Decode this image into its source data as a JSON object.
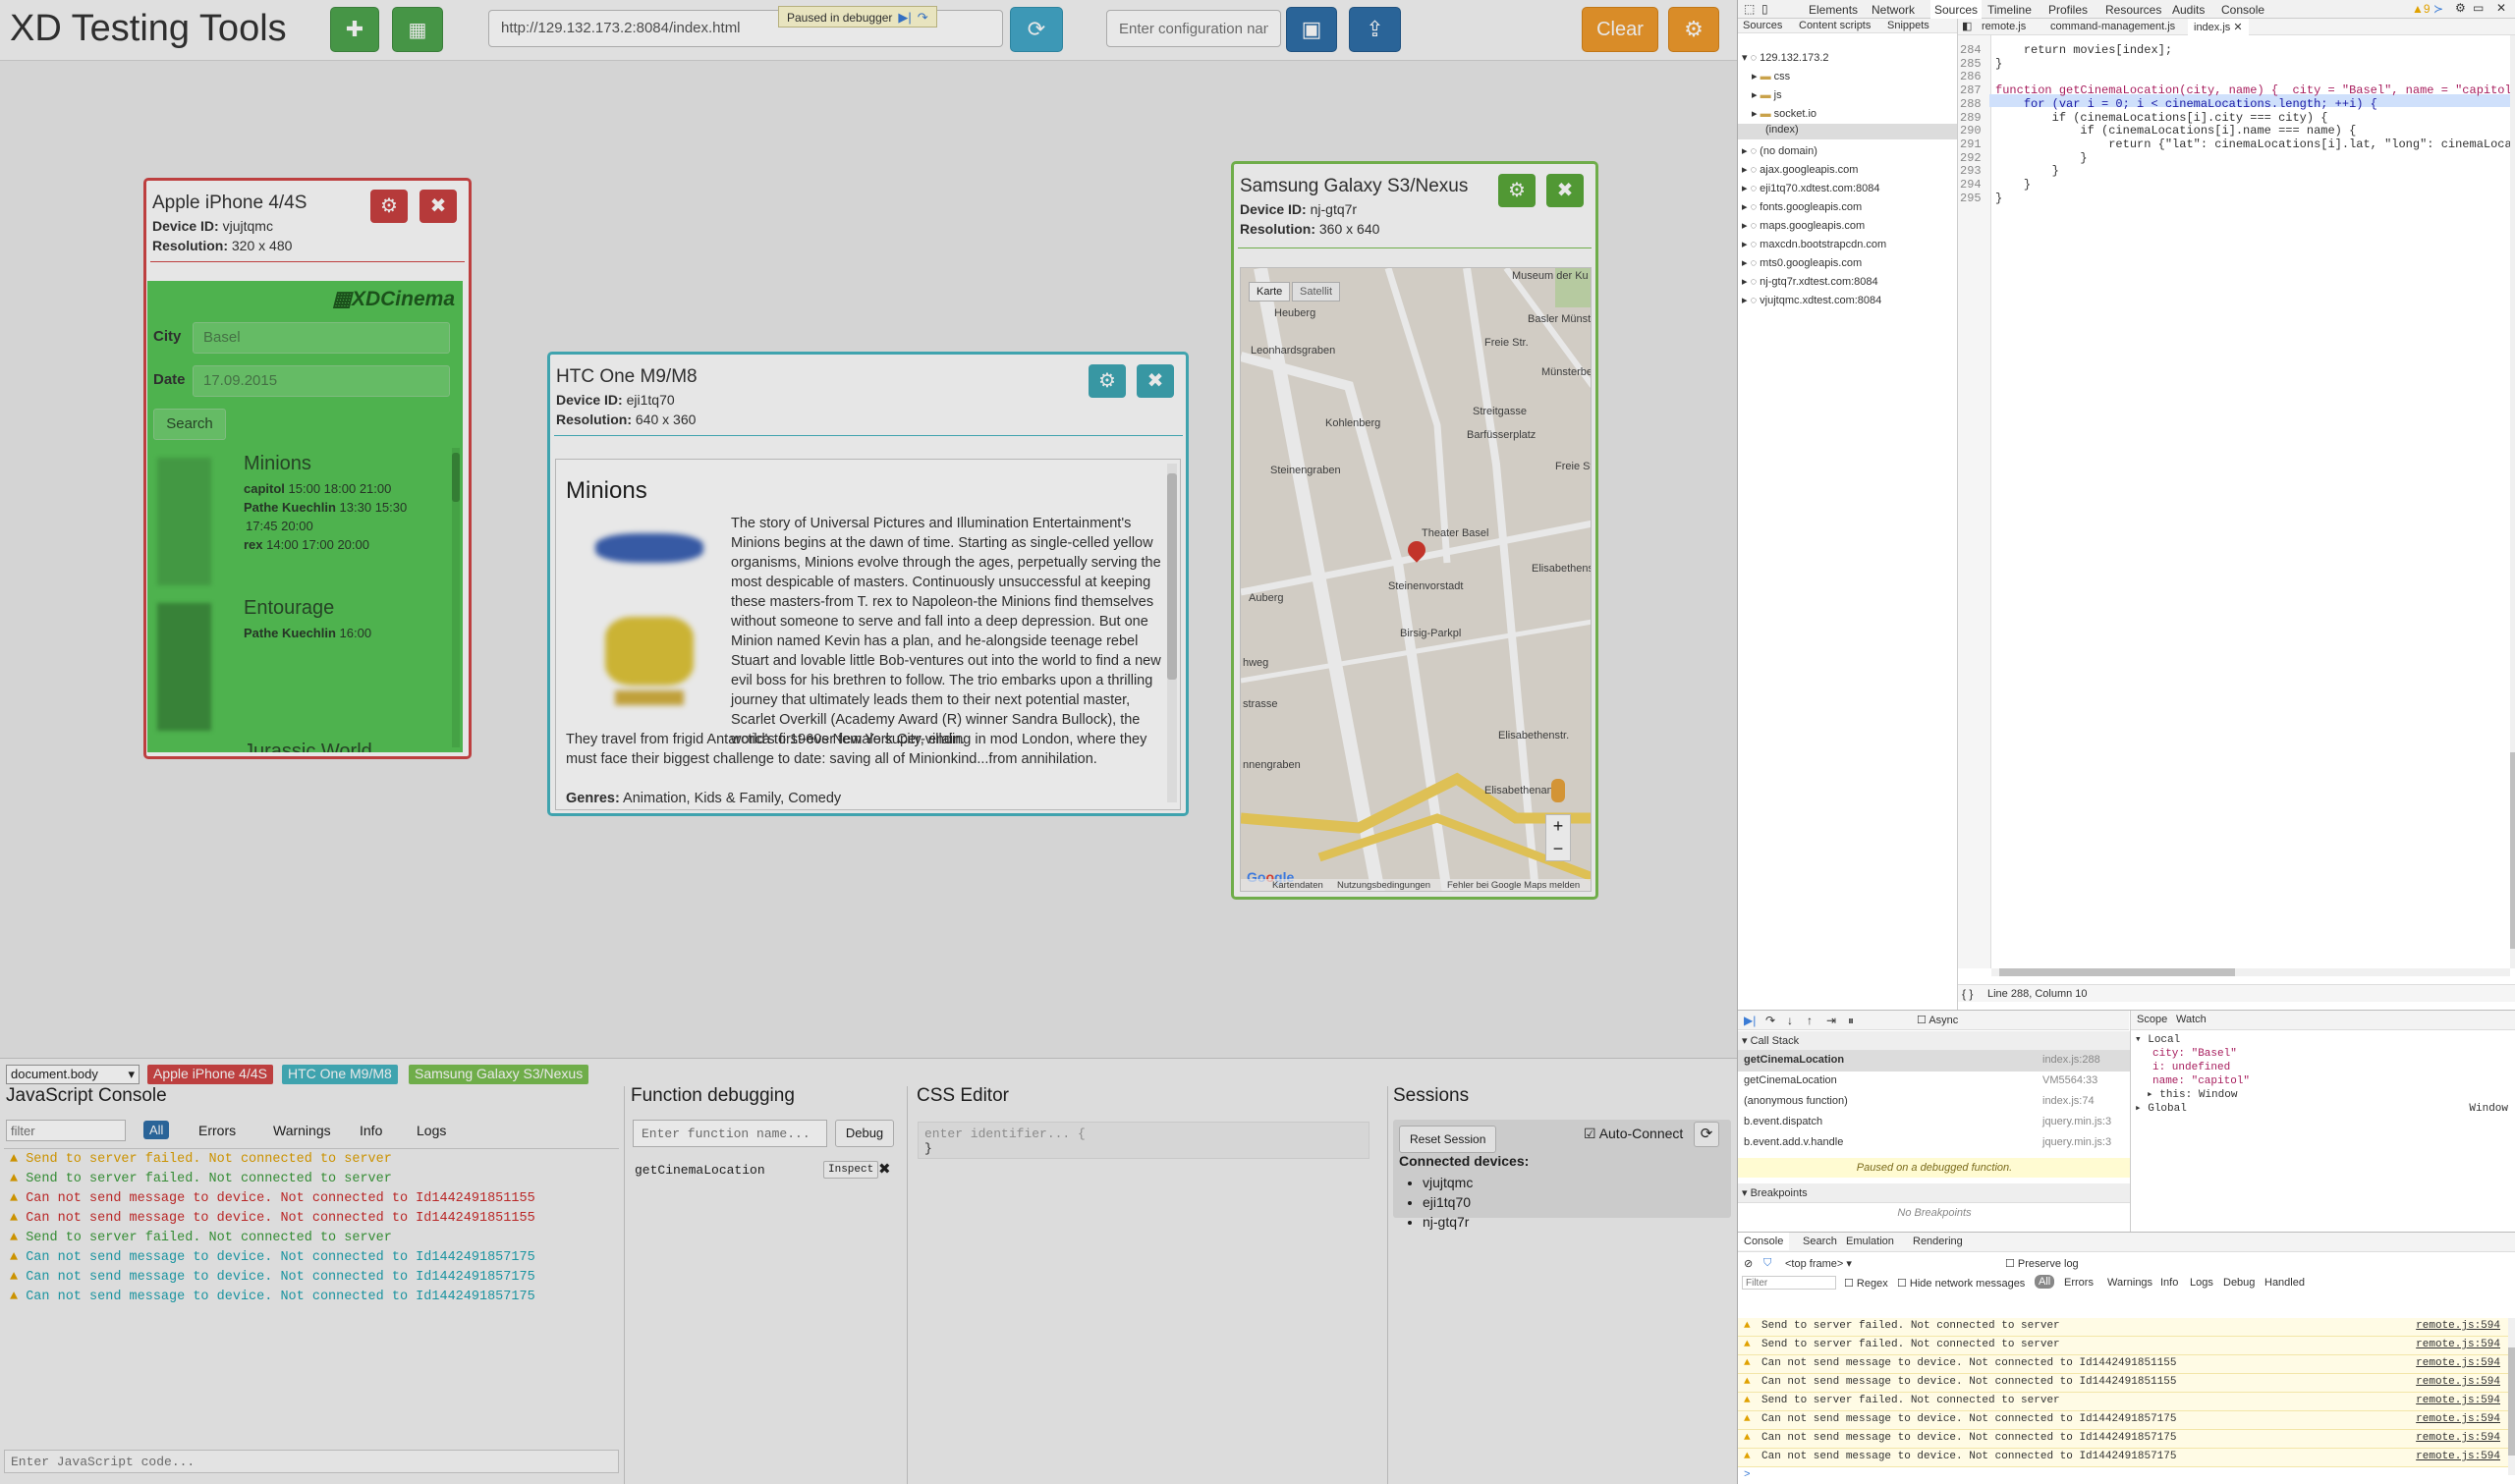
{
  "app": {
    "title": "XD Testing Tools",
    "url": "http://129.132.173.2:8084/index.html",
    "config_placeholder": "Enter configuration nam",
    "clear_label": "Clear",
    "paused_label": "Paused in debugger"
  },
  "iphone": {
    "name": "Apple iPhone 4/4S",
    "device_id": "vjujtqmc",
    "resolution": "320 x 480",
    "logo": "XDCinema",
    "city_label": "City",
    "city_value": "Basel",
    "date_label": "Date",
    "date_value": "17.09.2015",
    "search_label": "Search",
    "movies": [
      {
        "title": "Minions",
        "lines": [
          [
            "capitol",
            "15:00   18:00   21:00"
          ],
          [
            "Pathe Kuechlin",
            "13:30   15:30"
          ],
          [
            "",
            "17:45   20:00"
          ],
          [
            "rex",
            "14:00   17:00   20:00"
          ]
        ]
      },
      {
        "title": "Entourage",
        "lines": [
          [
            "Pathe Kuechlin",
            "16:00"
          ]
        ]
      }
    ],
    "cut_title": "Jurassic World"
  },
  "htc": {
    "name": "HTC One M9/M8",
    "device_id": "eji1tq70",
    "resolution": "640 x 360",
    "movie_title": "Minions",
    "description_a": "The story of Universal Pictures and Illumination Entertainment's Minions begins at the dawn of time. Starting as single-celled yellow organisms, Minions evolve through the ages, perpetually serving the most despicable of masters. Continuously unsuccessful at keeping these masters-from T. rex to Napoleon-the Minions find themselves without someone to serve and fall into a deep depression. But one Minion named Kevin has a plan, and he-alongside teenage rebel Stuart and lovable little Bob-ventures out into the world to find a new evil boss for his brethren to follow. The trio embarks upon a thrilling journey that ultimately leads them to their next potential master, Scarlet Overkill (Academy Award (R) winner Sandra Bullock), the world's first-ever female super-villain.",
    "description_b": "They travel from frigid Antarctica to 1960s New York City, ending in mod London, where they must face their biggest challenge to date: saving all of Minionkind...from annihilation.",
    "genres_label": "Genres:",
    "genres": "Animation, Kids & Family, Comedy"
  },
  "samsung": {
    "name": "Samsung Galaxy S3/Nexus",
    "device_id": "nj-gtq7r",
    "resolution": "360 x 640",
    "map_tabs": [
      "Karte",
      "Satellit"
    ],
    "map_labels": [
      "Museum der Ku",
      "Basler Münst",
      "Heuberg",
      "Leonhardsgraben",
      "Kohlenberg",
      "Freie Str.",
      "Streitgasse",
      "Münsterberg",
      "Barfüsserplatz",
      "Freie Str.",
      "Steinengraben",
      "Theater Basel",
      "Auberg",
      "Steinenvorstadt",
      "Birsig-Parkpl",
      "Elisabethenstrasse",
      "Elisabethenstr.",
      "Elisabethenanl",
      "hweg",
      "strasse",
      "nnengraben",
      "Kartendaten",
      "Nutzungsbedingungen",
      "Fehler bei Google Maps melden"
    ],
    "zoom_in": "+",
    "zoom_out": "−"
  },
  "bottom": {
    "selector": "document.body",
    "device_tags": [
      "Apple iPhone 4/4S",
      "HTC One M9/M8",
      "Samsung Galaxy S3/Nexus"
    ],
    "js_console": {
      "title": "JavaScript Console",
      "filter_placeholder": "filter",
      "filters": [
        "All",
        "Errors",
        "Warnings",
        "Info",
        "Logs"
      ],
      "input_placeholder": "Enter JavaScript code...",
      "lines": [
        {
          "text": "Send to server failed. Not connected to server",
          "kind": "warn"
        },
        {
          "text": "Send to server failed. Not connected to server",
          "kind": "ok"
        },
        {
          "text": "Can not send message to device. Not connected to Id1442491851155",
          "kind": "err"
        },
        {
          "text": "Can not send message to device. Not connected to Id1442491851155",
          "kind": "err"
        },
        {
          "text": "Send to server failed. Not connected to server",
          "kind": "ok"
        },
        {
          "text": "Can not send message to device. Not connected to Id1442491857175",
          "kind": "teal"
        },
        {
          "text": "Can not send message to device. Not connected to Id1442491857175",
          "kind": "teal"
        },
        {
          "text": "Can not send message to device. Not connected to Id1442491857175",
          "kind": "teal"
        }
      ]
    },
    "func_debug": {
      "title": "Function debugging",
      "placeholder": "Enter function name...",
      "debug_label": "Debug",
      "entry": "getCinemaLocation",
      "inspect_label": "Inspect"
    },
    "css_editor": {
      "title": "CSS Editor",
      "placeholder": "enter identifier... {",
      "close": "}"
    },
    "sessions": {
      "title": "Sessions",
      "reset_label": "Reset Session",
      "auto_label": "Auto-Connect",
      "connected_label": "Connected devices:",
      "devices": [
        "vjujtqmc",
        "eji1tq70",
        "nj-gtq7r"
      ]
    }
  },
  "devtools": {
    "tabs": [
      "Elements",
      "Network",
      "Sources",
      "Timeline",
      "Profiles",
      "Resources",
      "Audits",
      "Console"
    ],
    "warn_count": "9",
    "nav_tabs": [
      "Sources",
      "Content scripts",
      "Snippets"
    ],
    "file_tabs": [
      "remote.js",
      "command-management.js",
      "index.js"
    ],
    "tree": [
      "129.132.173.2",
      "css",
      "js",
      "socket.io",
      "(index)",
      "(no domain)",
      "ajax.googleapis.com",
      "eji1tq70.xdtest.com:8084",
      "fonts.googleapis.com",
      "maps.googleapis.com",
      "maxcdn.bootstrapcdn.com",
      "mts0.googleapis.com",
      "nj-gtq7r.xdtest.com:8084",
      "vjujtqmc.xdtest.com:8084"
    ],
    "code": [
      {
        "n": "284",
        "t": "    return movies[index];"
      },
      {
        "n": "285",
        "t": "}"
      },
      {
        "n": "286",
        "t": ""
      },
      {
        "n": "287",
        "t": "function getCinemaLocation(city, name) {  city = \"Basel\", name = \"capitol\""
      },
      {
        "n": "288",
        "t": "    for (var i = 0; i < cinemaLocations.length; ++i) {"
      },
      {
        "n": "289",
        "t": "        if (cinemaLocations[i].city === city) {"
      },
      {
        "n": "290",
        "t": "            if (cinemaLocations[i].name === name) {"
      },
      {
        "n": "291",
        "t": "                return {\"lat\": cinemaLocations[i].lat, \"long\": cinemaLocations"
      },
      {
        "n": "292",
        "t": "            }"
      },
      {
        "n": "293",
        "t": "        }"
      },
      {
        "n": "294",
        "t": "    }"
      },
      {
        "n": "295",
        "t": "}"
      }
    ],
    "status": "Line 288, Column 10",
    "async_label": "Async",
    "call_stack_label": "Call Stack",
    "stack": [
      [
        "getCinemaLocation",
        "index.js:288"
      ],
      [
        "getCinemaLocation",
        "VM5564:33"
      ],
      [
        "(anonymous function)",
        "index.js:74"
      ],
      [
        "b.event.dispatch",
        "jquery.min.js:3"
      ],
      [
        "b.event.add.v.handle",
        "jquery.min.js:3"
      ]
    ],
    "paused_msg": "Paused on a debugged function.",
    "breakpoints_label": "Breakpoints",
    "no_bp": "No Breakpoints",
    "scope_tabs": [
      "Scope",
      "Watch"
    ],
    "scope_local": "Local",
    "scope_vars": [
      "city: \"Basel\"",
      "i: undefined",
      "name: \"capitol\"",
      "this: Window"
    ],
    "scope_global": "Global",
    "scope_global_val": "Window",
    "drawer_tabs": [
      "Console",
      "Search",
      "Emulation",
      "Rendering"
    ],
    "frame": "<top frame>",
    "preserve_log": "Preserve log",
    "filter_placeholder": "Filter",
    "regex": "Regex",
    "hide_net": "Hide network messages",
    "levels": [
      "All",
      "Errors",
      "Warnings",
      "Info",
      "Logs",
      "Debug",
      "Handled"
    ],
    "console_lines": [
      [
        "Send to server failed. Not connected to server",
        "remote.js:594"
      ],
      [
        "Send to server failed. Not connected to server",
        "remote.js:594"
      ],
      [
        "Can not send message to device. Not connected to Id1442491851155",
        "remote.js:594"
      ],
      [
        "Can not send message to device. Not connected to Id1442491851155",
        "remote.js:594"
      ],
      [
        "Send to server failed. Not connected to server",
        "remote.js:594"
      ],
      [
        "Can not send message to device. Not connected to Id1442491857175",
        "remote.js:594"
      ],
      [
        "Can not send message to device. Not connected to Id1442491857175",
        "remote.js:594"
      ],
      [
        "Can not send message to device. Not connected to Id1442491857175",
        "remote.js:594"
      ]
    ],
    "prompt": ">"
  },
  "colors": {
    "green": "#4ea44e",
    "blue": "#2f6ea8",
    "cyan": "#44a8c8",
    "orange": "#ef9a2d",
    "iphone_border": "#d04646",
    "htc_border": "#46b4c0",
    "samsung_border": "#7bbf52"
  }
}
